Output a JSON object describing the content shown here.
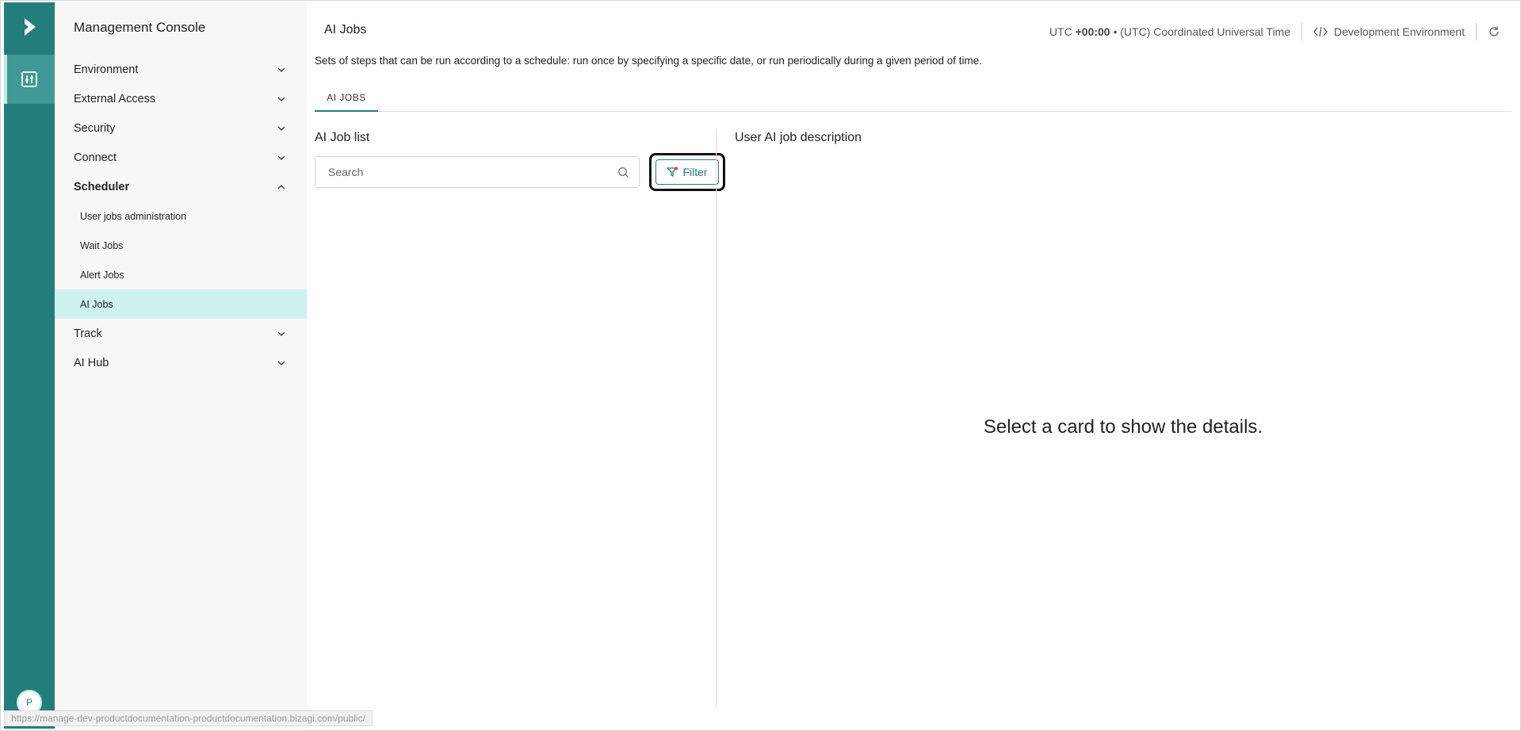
{
  "rail": {
    "logo_icon": "bizagi-logo-icon",
    "active_item_icon": "console-settings-icon",
    "avatar_initial": "P"
  },
  "sidebar": {
    "title": "Management Console",
    "items": [
      {
        "label": "Environment",
        "icon": "chevron-down-icon"
      },
      {
        "label": "External Access",
        "icon": "chevron-down-icon"
      },
      {
        "label": "Security",
        "icon": "chevron-down-icon"
      },
      {
        "label": "Connect",
        "icon": "chevron-down-icon"
      },
      {
        "label": "Scheduler",
        "icon": "chevron-up-icon",
        "expanded": true,
        "children": [
          {
            "label": "User jobs administration"
          },
          {
            "label": "Wait Jobs"
          },
          {
            "label": "Alert Jobs"
          },
          {
            "label": "AI Jobs",
            "active": true
          }
        ]
      },
      {
        "label": "Track",
        "icon": "chevron-down-icon"
      },
      {
        "label": "AI Hub",
        "icon": "chevron-down-icon"
      }
    ]
  },
  "header": {
    "title": "AI Jobs",
    "tz_prefix": "UTC ",
    "tz_offset": "+00:00",
    "tz_name": " • (UTC) Coordinated Universal Time",
    "environment": "Development Environment",
    "description": "Sets of steps that can be run according to a schedule: run once by specifying a specific date, or run periodically during a given period of time."
  },
  "tabs": [
    {
      "label": "AI JOBS",
      "active": true
    }
  ],
  "list_panel": {
    "title": "AI Job list",
    "search_placeholder": "Search",
    "filter_label": "Filter"
  },
  "detail_panel": {
    "title": "User AI job description",
    "empty_message": "Select a card to show the details."
  },
  "status_bar": {
    "url": "https://manage-dev-productdocumentation-productdocumentation.bizagi.com/public/"
  },
  "colors": {
    "brand": "#237e7b",
    "active_bg": "#cdf2ef",
    "filter_badge": "#e0443e"
  }
}
